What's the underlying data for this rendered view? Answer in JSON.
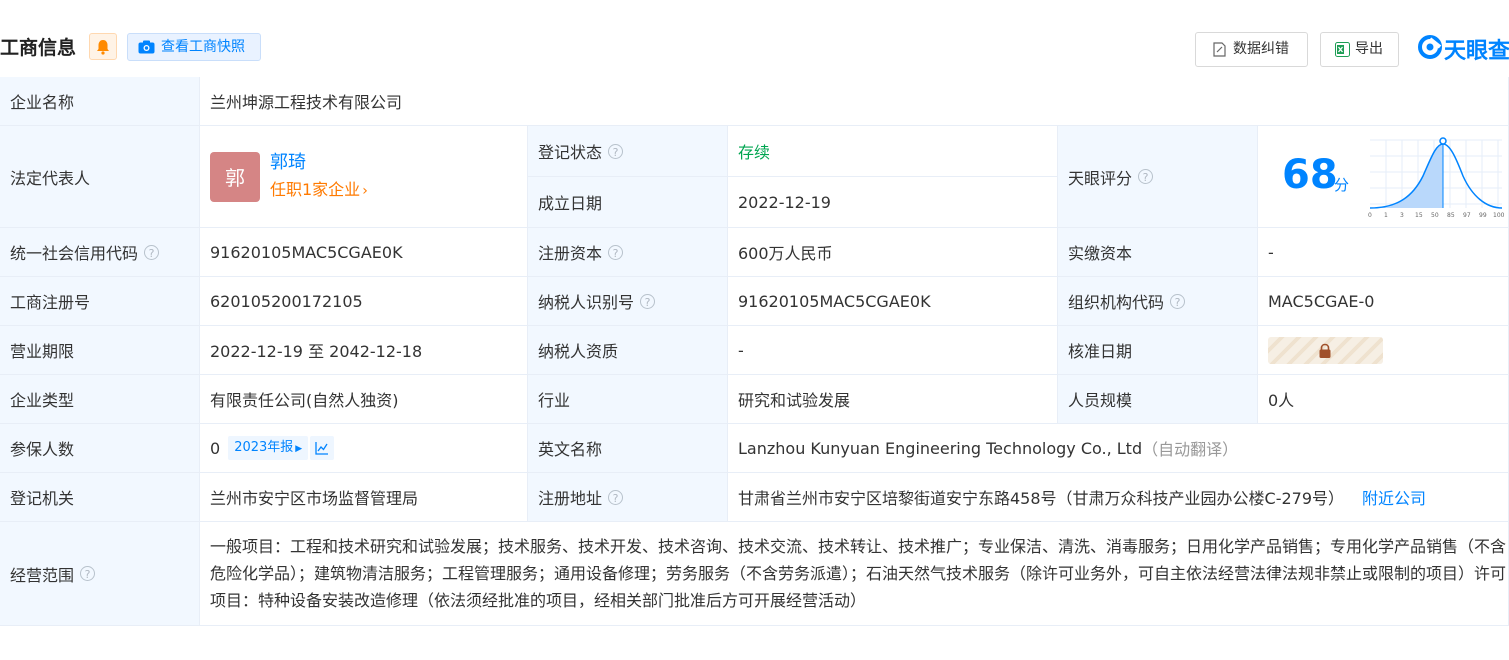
{
  "header": {
    "title": "工商信息",
    "snapshot_label": "查看工商快照",
    "correct_label": "数据纠错",
    "export_label": "导出",
    "logo_text": "天眼查",
    "accent_color": "#0084ff"
  },
  "rows": {
    "company_name": {
      "label": "企业名称",
      "value": "兰州坤源工程技术有限公司"
    },
    "legal_rep": {
      "label": "法定代表人",
      "avatar_char": "郭",
      "name": "郭琦",
      "sub": "任职1家企业"
    },
    "reg_status": {
      "label": "登记状态",
      "value": "存续"
    },
    "found_date": {
      "label": "成立日期",
      "value": "2022-12-19"
    },
    "score": {
      "label": "天眼评分",
      "value": "68",
      "unit": "分",
      "axis": [
        "0",
        "1",
        "3",
        "15",
        "50",
        "85",
        "97",
        "99",
        "100"
      ]
    },
    "credit_code": {
      "label": "统一社会信用代码",
      "value": "91620105MAC5CGAE0K"
    },
    "reg_capital": {
      "label": "注册资本",
      "value": "600万人民币"
    },
    "paid_capital": {
      "label": "实缴资本",
      "value": "-"
    },
    "reg_no": {
      "label": "工商注册号",
      "value": "620105200172105"
    },
    "taxpayer_id": {
      "label": "纳税人识别号",
      "value": "91620105MAC5CGAE0K"
    },
    "org_code": {
      "label": "组织机构代码",
      "value": "MAC5CGAE-0"
    },
    "term": {
      "label": "营业期限",
      "value": "2022-12-19 至 2042-12-18"
    },
    "tax_qual": {
      "label": "纳税人资质",
      "value": "-"
    },
    "approve_date": {
      "label": "核准日期"
    },
    "company_type": {
      "label": "企业类型",
      "value": "有限责任公司(自然人独资)"
    },
    "industry": {
      "label": "行业",
      "value": "研究和试验发展"
    },
    "staff": {
      "label": "人员规模",
      "value": "0人"
    },
    "insured": {
      "label": "参保人数",
      "value": "0",
      "year_badge": "2023年报"
    },
    "english_name": {
      "label": "英文名称",
      "value": "Lanzhou Kunyuan Engineering Technology Co., Ltd",
      "note": "（自动翻译）"
    },
    "authority": {
      "label": "登记机关",
      "value": "兰州市安宁区市场监督管理局"
    },
    "address": {
      "label": "注册地址",
      "value": "甘肃省兰州市安宁区培黎街道安宁东路458号（甘肃万众科技产业园办公楼C-279号）",
      "link": "附近公司"
    },
    "scope": {
      "label": "经营范围",
      "value": "一般项目：工程和技术研究和试验发展；技术服务、技术开发、技术咨询、技术交流、技术转让、技术推广；专业保洁、清洗、消毒服务；日用化学产品销售；专用化学产品销售（不含危险化学品）；建筑物清洁服务；工程管理服务；通用设备修理；劳务服务（不含劳务派遣）；石油天然气技术服务（除许可业务外，可自主依法经营法律法规非禁止或限制的项目）许可项目：特种设备安装改造修理（依法须经批准的项目，经相关部门批准后方可开展经营活动）"
    }
  }
}
